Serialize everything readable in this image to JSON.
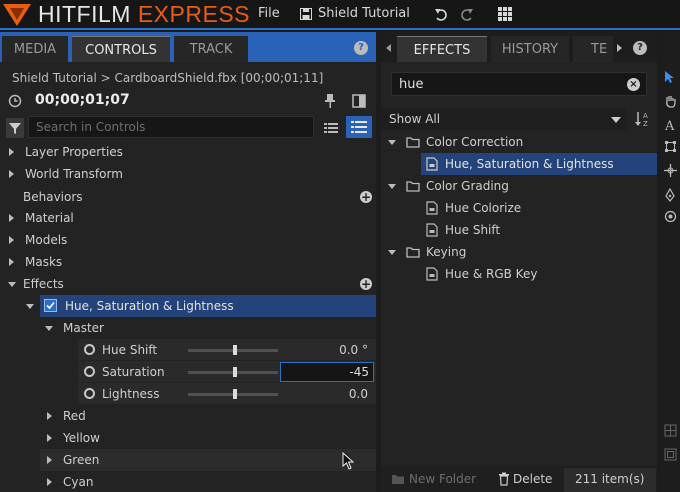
{
  "app": {
    "brand_part1": "HITFILM",
    "brand_part2": "EXPRESS",
    "menu_file": "File",
    "project_name": "Shield Tutorial",
    "accent": "#2d6fc4",
    "brand_color": "#e85d12"
  },
  "left_panel": {
    "tabs": [
      "MEDIA",
      "CONTROLS",
      "TRACK"
    ],
    "active_tab": "CONTROLS",
    "help": "?",
    "path": "Shield Tutorial > CardboardShield.fbx [00;00;01;11]",
    "timecode": "00;00;01;07",
    "search_placeholder": "Search in Controls",
    "rows": {
      "layer_properties": "Layer Properties",
      "world_transform": "World Transform",
      "behaviors": "Behaviors",
      "material": "Material",
      "models": "Models",
      "masks": "Masks",
      "effects": "Effects",
      "effect_name": "Hue, Saturation & Lightness",
      "master": "Master",
      "red": "Red",
      "yellow": "Yellow",
      "green": "Green",
      "cyan": "Cyan"
    },
    "properties": {
      "hue_shift": {
        "label": "Hue Shift",
        "value": "0.0 °",
        "level": 0.5
      },
      "saturation": {
        "label": "Saturation",
        "value": "-45",
        "level": 0.5
      },
      "lightness": {
        "label": "Lightness",
        "value": "0.0",
        "level": 0.5
      }
    }
  },
  "right_panel": {
    "tabs": [
      "EFFECTS",
      "HISTORY",
      "TEXT"
    ],
    "tab_text_visible": "TE",
    "active_tab": "EFFECTS",
    "help": "?",
    "search_value": "hue",
    "filter": "Show All",
    "tree": {
      "color_correction": "Color Correction",
      "hsl": "Hue, Saturation & Lightness",
      "color_grading": "Color Grading",
      "hue_colorize": "Hue Colorize",
      "hue_shift": "Hue Shift",
      "keying": "Keying",
      "hue_rgb_key": "Hue & RGB Key"
    },
    "new_folder": "New Folder",
    "delete": "Delete",
    "item_count": "211 item(s)"
  }
}
